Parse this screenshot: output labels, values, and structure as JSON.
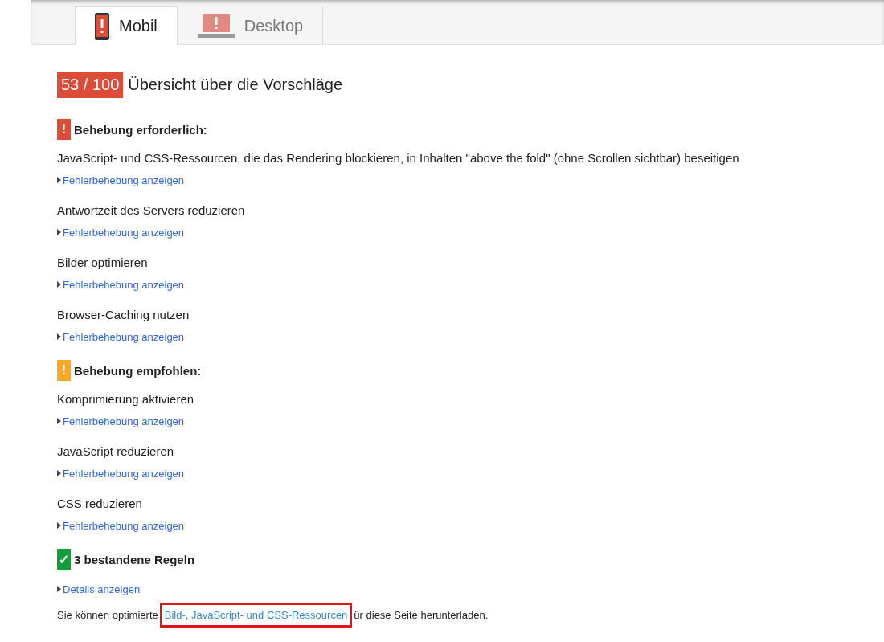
{
  "tabs": [
    {
      "label": "Mobil",
      "kind": "mobile",
      "selected": true
    },
    {
      "label": "Desktop",
      "kind": "desktop",
      "selected": false
    }
  ],
  "score": "53 / 100",
  "title": "Übersicht über die Vorschläge",
  "sections": [
    {
      "kind": "error",
      "badge": "!",
      "heading": "Behebung erforderlich:",
      "rules": [
        {
          "title": "JavaScript- und CSS-Ressourcen, die das Rendering blockieren, in Inhalten \"above the fold\" (ohne Scrollen sichtbar) beseitigen",
          "link": "Fehlerbehebung anzeigen"
        },
        {
          "title": "Antwortzeit des Servers reduzieren",
          "link": "Fehlerbehebung anzeigen"
        },
        {
          "title": "Bilder optimieren",
          "link": "Fehlerbehebung anzeigen"
        },
        {
          "title": "Browser-Caching nutzen",
          "link": "Fehlerbehebung anzeigen"
        }
      ]
    },
    {
      "kind": "warning",
      "badge": "!",
      "heading": "Behebung empfohlen:",
      "rules": [
        {
          "title": "Komprimierung aktivieren",
          "link": "Fehlerbehebung anzeigen"
        },
        {
          "title": "JavaScript reduzieren",
          "link": "Fehlerbehebung anzeigen"
        },
        {
          "title": "CSS reduzieren",
          "link": "Fehlerbehebung anzeigen"
        }
      ]
    },
    {
      "kind": "passed",
      "badge": "✓",
      "heading": "3 bestandene Regeln",
      "link": "Details anzeigen"
    }
  ],
  "footer": {
    "before": "Sie können optimierte",
    "link": "Bild-, JavaScript- und CSS-Ressourcen",
    "after": "ür diese Seite herunterladen.",
    "highlighted": true
  }
}
